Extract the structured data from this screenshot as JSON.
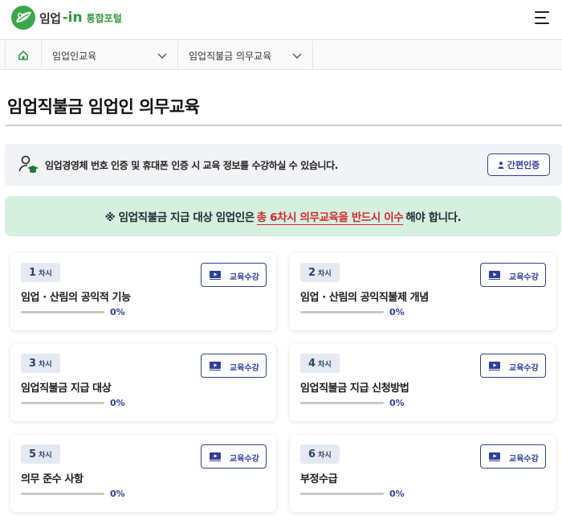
{
  "header": {
    "logo_text": "임업",
    "logo_in": "-in",
    "logo_portal": "통합포털",
    "brand_color": "#2e9a3c"
  },
  "breadcrumb": {
    "home_icon": "home-icon",
    "items": [
      {
        "label": "임업인교육"
      },
      {
        "label": "임업직불금 의무교육"
      }
    ]
  },
  "page": {
    "title": "임업직불금 임업인 의무교육"
  },
  "info": {
    "icon": "user-graduate-icon",
    "text": "임업경영체 번호 인증 및 휴대폰 인증 시 교육 정보를 수강하실 수 있습니다.",
    "auth_button": "간편인증"
  },
  "notice": {
    "prefix": "※ 임업직불금 지급 대상 임업인은",
    "highlight": "총 6차시 의무교육을 반드시 이수",
    "suffix": "해야 합니다.",
    "highlight_color": "#d6262e",
    "bg_color": "#d5f0de"
  },
  "sessions": [
    {
      "num": "1",
      "suffix": "차시",
      "title": "임업 · 산림의 공익적 기능",
      "progress": 0,
      "progress_label": "0%",
      "button": "교육수강"
    },
    {
      "num": "2",
      "suffix": "차시",
      "title": "임업 · 산림의 공익직불제 개념",
      "progress": 0,
      "progress_label": "0%",
      "button": "교육수강"
    },
    {
      "num": "3",
      "suffix": "차시",
      "title": "임업직불금 지급 대상",
      "progress": 0,
      "progress_label": "0%",
      "button": "교육수강"
    },
    {
      "num": "4",
      "suffix": "차시",
      "title": "임업직불금 지급 신청방법",
      "progress": 0,
      "progress_label": "0%",
      "button": "교육수강"
    },
    {
      "num": "5",
      "suffix": "차시",
      "title": "의무 준수 사항",
      "progress": 0,
      "progress_label": "0%",
      "button": "교육수강"
    },
    {
      "num": "6",
      "suffix": "차시",
      "title": "부정수급",
      "progress": 0,
      "progress_label": "0%",
      "button": "교육수강"
    }
  ],
  "colors": {
    "accent": "#2d3f9e",
    "badge_bg": "#e4e9f2"
  }
}
